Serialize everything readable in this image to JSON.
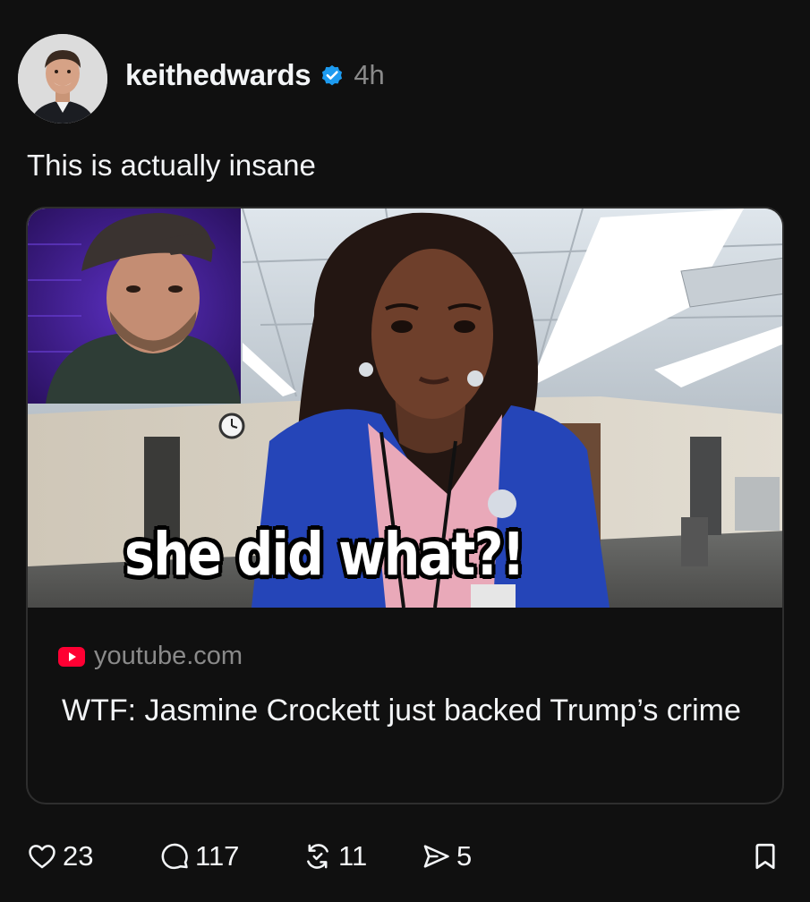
{
  "post": {
    "username": "keithedwards",
    "timestamp": "4h",
    "text": "This is actually insane"
  },
  "link_card": {
    "thumbnail_caption": "she did what?!",
    "domain": "youtube.com",
    "title": "WTF: Jasmine Crockett just backed Trump’s crime"
  },
  "actions": {
    "likes": "23",
    "replies": "117",
    "reposts": "11",
    "shares": "5"
  },
  "icons": {
    "verified": "verified-badge-icon",
    "like": "heart-icon",
    "reply": "comment-bubble-icon",
    "repost": "repost-icon",
    "share": "send-icon",
    "save": "bookmark-icon",
    "source": "youtube-icon"
  },
  "colors": {
    "background": "#101010",
    "text": "#f3f5f7",
    "muted": "#8a8a8a",
    "verified": "#1d9bf0",
    "youtube": "#ff0033"
  }
}
